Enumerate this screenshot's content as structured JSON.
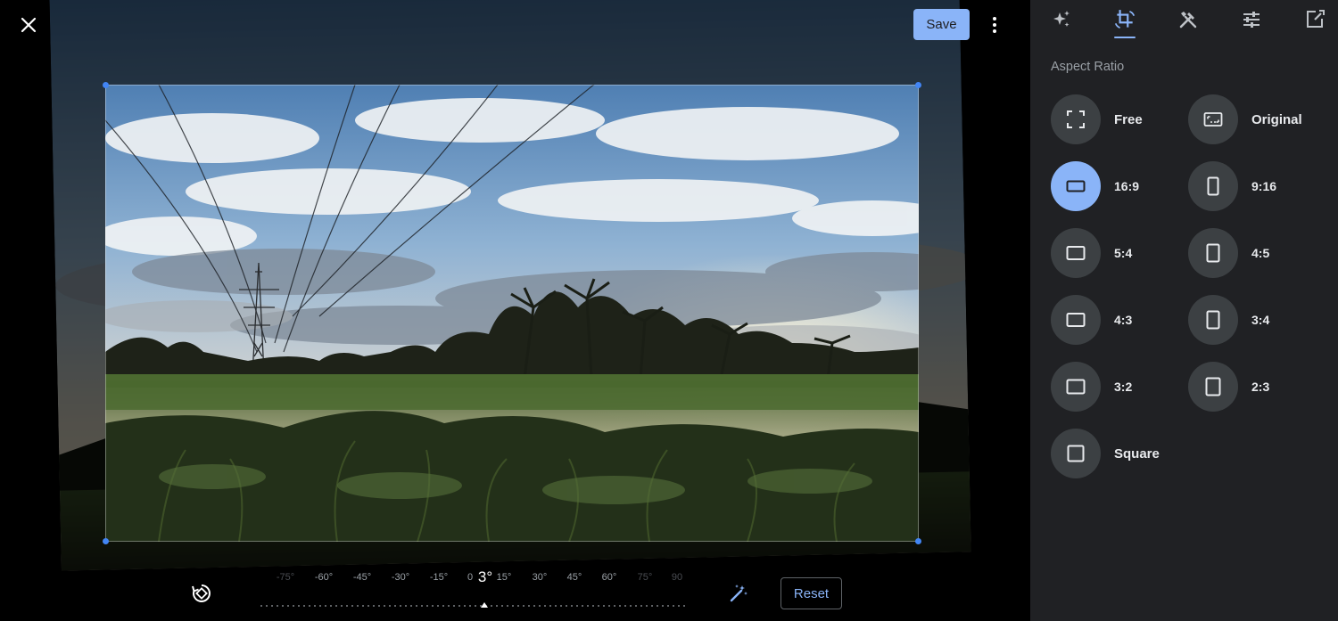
{
  "header": {
    "close_icon": "close-icon",
    "save_label": "Save",
    "more_icon": "more-vert-icon"
  },
  "toolbar": {
    "rotate_icon": "rotate-icon",
    "angle_value": "3°",
    "auto_icon": "auto-fix-icon",
    "reset_label": "Reset",
    "ticks": [
      "-75°",
      "-60°",
      "-45°",
      "-30°",
      "-15°",
      "0",
      "15°",
      "30°",
      "45°",
      "60°",
      "75°",
      "90"
    ]
  },
  "panel": {
    "tabs": [
      {
        "name": "suggestions",
        "icon": "sparkle-icon"
      },
      {
        "name": "crop",
        "icon": "crop-rotate-icon",
        "active": true
      },
      {
        "name": "tools",
        "icon": "tools-icon"
      },
      {
        "name": "adjust",
        "icon": "sliders-icon"
      },
      {
        "name": "markup",
        "icon": "markup-icon"
      }
    ],
    "section_title": "Aspect Ratio",
    "ratios": [
      {
        "label": "Free",
        "icon": "free-crop-icon"
      },
      {
        "label": "Original",
        "icon": "original-ratio-icon"
      },
      {
        "label": "16:9",
        "icon": "landscape-icon",
        "selected": true
      },
      {
        "label": "9:16",
        "icon": "portrait-icon"
      },
      {
        "label": "5:4",
        "icon": "landscape-icon"
      },
      {
        "label": "4:5",
        "icon": "portrait-icon"
      },
      {
        "label": "4:3",
        "icon": "landscape-icon"
      },
      {
        "label": "3:4",
        "icon": "portrait-icon"
      },
      {
        "label": "3:2",
        "icon": "landscape-icon"
      },
      {
        "label": "2:3",
        "icon": "portrait-icon"
      },
      {
        "label": "Square",
        "icon": "square-icon"
      }
    ]
  },
  "colors": {
    "accent": "#8ab4f8",
    "handle": "#4285f4",
    "panel_bg": "#202124",
    "chip_bg": "#3c4043"
  }
}
